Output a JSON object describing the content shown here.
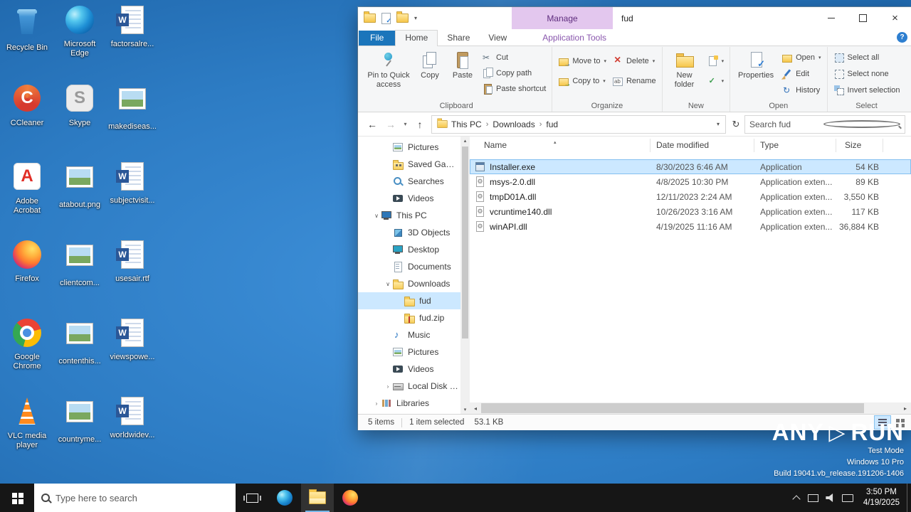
{
  "desktop": {
    "icons": [
      {
        "label": "Recycle Bin",
        "type": "recycle",
        "col": 0,
        "row": 0
      },
      {
        "label": "CCleaner",
        "type": "ccleaner",
        "col": 0,
        "row": 1
      },
      {
        "label": "Adobe Acrobat",
        "type": "acrobat",
        "col": 0,
        "row": 2
      },
      {
        "label": "Firefox",
        "type": "firefox",
        "col": 0,
        "row": 3
      },
      {
        "label": "Google Chrome",
        "type": "chrome",
        "col": 0,
        "row": 4
      },
      {
        "label": "VLC media player",
        "type": "vlc",
        "col": 0,
        "row": 5
      },
      {
        "label": "Microsoft Edge",
        "type": "edge",
        "col": 1,
        "row": 0
      },
      {
        "label": "Skype",
        "type": "skype",
        "col": 1,
        "row": 1
      },
      {
        "label": "atabout.png",
        "type": "image",
        "col": 1,
        "row": 2
      },
      {
        "label": "clientcom...",
        "type": "image",
        "col": 1,
        "row": 3
      },
      {
        "label": "contenthis...",
        "type": "image",
        "col": 1,
        "row": 4
      },
      {
        "label": "countryme...",
        "type": "image",
        "col": 1,
        "row": 5
      },
      {
        "label": "factorsalre...",
        "type": "word",
        "col": 2,
        "row": 0
      },
      {
        "label": "makediseas...",
        "type": "image",
        "col": 2,
        "row": 1
      },
      {
        "label": "subjectvisit...",
        "type": "word",
        "col": 2,
        "row": 2
      },
      {
        "label": "usesair.rtf",
        "type": "word",
        "col": 2,
        "row": 3
      },
      {
        "label": "viewspowe...",
        "type": "word",
        "col": 2,
        "row": 4
      },
      {
        "label": "worldwidev...",
        "type": "word",
        "col": 2,
        "row": 5
      }
    ]
  },
  "explorer": {
    "window_title": "fud",
    "contextual_group": "Manage",
    "help_label": "?",
    "tabs": {
      "file": "File",
      "home": "Home",
      "share": "Share",
      "view": "View",
      "contextual": "Application Tools"
    },
    "ribbon": {
      "pin": "Pin to Quick access",
      "copy": "Copy",
      "paste": "Paste",
      "cut": "Cut",
      "copy_path": "Copy path",
      "paste_shortcut": "Paste shortcut",
      "move_to": "Move to",
      "copy_to": "Copy to",
      "delete": "Delete",
      "rename": "Rename",
      "new_folder": "New folder",
      "properties": "Properties",
      "open": "Open",
      "edit": "Edit",
      "history": "History",
      "select_all": "Select all",
      "select_none": "Select none",
      "invert_selection": "Invert selection",
      "groups": {
        "clipboard": "Clipboard",
        "organize": "Organize",
        "new": "New",
        "open": "Open",
        "select": "Select"
      }
    },
    "nav": {
      "crumbs": [
        "This PC",
        "Downloads",
        "fud"
      ],
      "search_placeholder": "Search fud"
    },
    "sidebar": [
      {
        "label": "Pictures",
        "icon": "pictures",
        "indent": 2
      },
      {
        "label": "Saved Games",
        "icon": "games",
        "indent": 2
      },
      {
        "label": "Searches",
        "icon": "searches",
        "indent": 2
      },
      {
        "label": "Videos",
        "icon": "videos",
        "indent": 2
      },
      {
        "label": "This PC",
        "icon": "pc",
        "indent": 1,
        "expanded": true
      },
      {
        "label": "3D Objects",
        "icon": "o3d",
        "indent": 2
      },
      {
        "label": "Desktop",
        "icon": "desk",
        "indent": 2
      },
      {
        "label": "Documents",
        "icon": "docs",
        "indent": 2
      },
      {
        "label": "Downloads",
        "icon": "dl",
        "indent": 2,
        "expanded": true
      },
      {
        "label": "fud",
        "icon": "folder",
        "indent": 3,
        "selected": true
      },
      {
        "label": "fud.zip",
        "icon": "zip",
        "indent": 3
      },
      {
        "label": "Music",
        "icon": "music",
        "indent": 2
      },
      {
        "label": "Pictures",
        "icon": "pictures",
        "indent": 2
      },
      {
        "label": "Videos",
        "icon": "videos",
        "indent": 2
      },
      {
        "label": "Local Disk (C:)",
        "icon": "disk",
        "indent": 2,
        "expandable": true
      },
      {
        "label": "Libraries",
        "icon": "lib",
        "indent": 1,
        "expandable": true
      }
    ],
    "columns": [
      "Name",
      "Date modified",
      "Type",
      "Size"
    ],
    "files": [
      {
        "name": "Installer.exe",
        "modified": "8/30/2023 6:46 AM",
        "type": "Application",
        "size": "54 KB",
        "icon": "exe",
        "selected": true
      },
      {
        "name": "msys-2.0.dll",
        "modified": "4/8/2025 10:30 PM",
        "type": "Application exten...",
        "size": "89 KB",
        "icon": "dll"
      },
      {
        "name": "tmpD01A.dll",
        "modified": "12/11/2023 2:24 AM",
        "type": "Application exten...",
        "size": "3,550 KB",
        "icon": "dll"
      },
      {
        "name": "vcruntime140.dll",
        "modified": "10/26/2023 3:16 AM",
        "type": "Application exten...",
        "size": "117 KB",
        "icon": "dll"
      },
      {
        "name": "winAPI.dll",
        "modified": "4/19/2025 11:16 AM",
        "type": "Application exten...",
        "size": "36,884 KB",
        "icon": "dll"
      }
    ],
    "status": {
      "items_count": "5 items",
      "selection": "1 item selected",
      "selection_size": "53.1 KB"
    }
  },
  "watermark": {
    "brand_left": "ANY",
    "brand_right": "RUN",
    "mode": "Test Mode",
    "os": "Windows 10 Pro",
    "build": "Build 19041.vb_release.191206-1406"
  },
  "taskbar": {
    "search_placeholder": "Type here to search",
    "time": "3:50 PM",
    "date": "4/19/2025"
  }
}
